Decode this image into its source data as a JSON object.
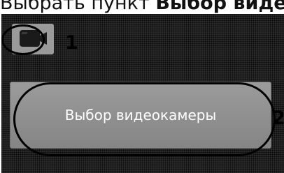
{
  "caption": {
    "text_regular": "Выбрать пункт ",
    "text_bold": "Выбор видео"
  },
  "camera_button": {
    "icon": "camera-icon"
  },
  "callouts": {
    "one": "1",
    "two": "2"
  },
  "select_camera_button": {
    "label": "Выбор видеокамеры"
  },
  "colors": {
    "panel_background": "#2a2a2a",
    "button_fill": "#909090",
    "button_text": "#ffffff",
    "annotation": "#000000"
  }
}
